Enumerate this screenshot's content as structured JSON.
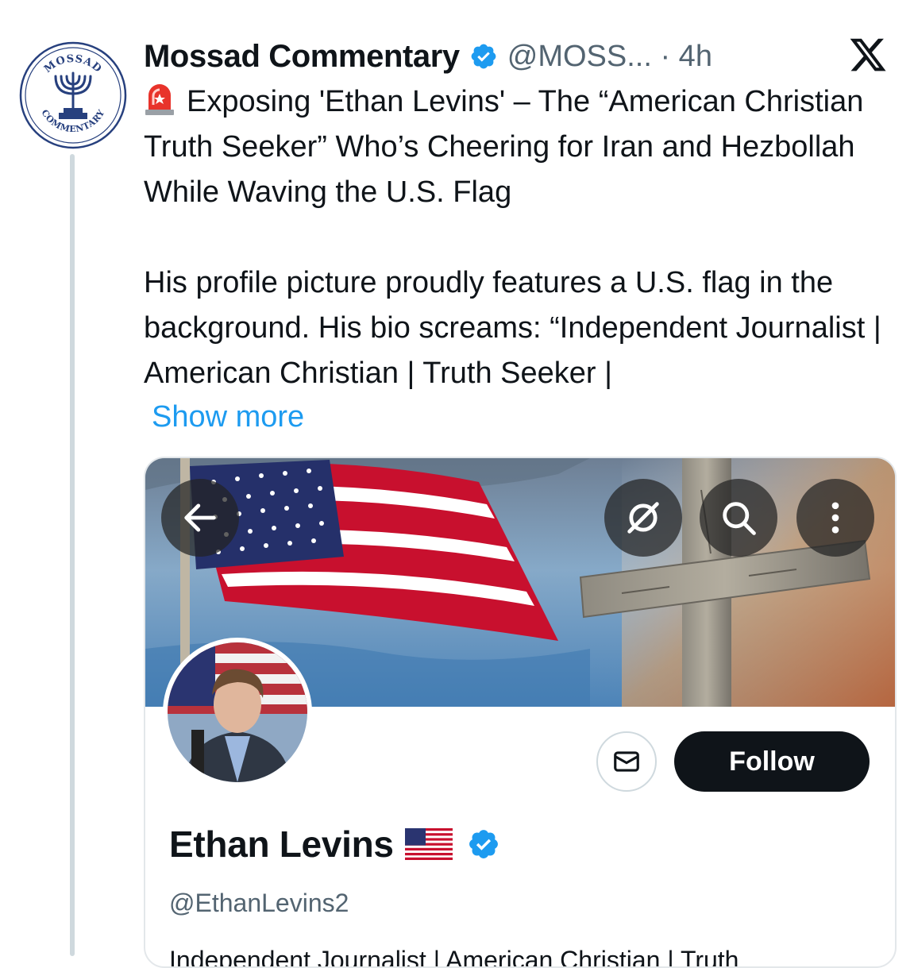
{
  "author": {
    "display_name": "Mossad Commentary",
    "handle_time": "@MOSS... · 4h",
    "avatar_text_top": "MOSSAD",
    "avatar_text_bottom": "COMMENTARY",
    "verified_icon": "verified-badge-icon"
  },
  "tweet": {
    "headline": "Exposing 'Ethan Levins' – The “American Christian Truth Seeker” Who’s Cheering for Iran and Hezbollah While Waving the U.S. Flag",
    "body": "His profile picture proudly features a U.S. flag in the background. His bio screams: “Independent Journalist | American Christian | Truth Seeker |",
    "show_more": "Show more"
  },
  "profile_card": {
    "name": "Ethan Levins",
    "handle": "@EthanLevins2",
    "follow_label": "Follow",
    "bio_peek": "Independent Journalist | American Christian | Truth"
  },
  "colors": {
    "accent_blue": "#1d9bf0",
    "text_primary": "#0f1419",
    "text_secondary": "#536471",
    "thread_line": "#cfd9de"
  },
  "icons": [
    "x-logo-icon",
    "siren-icon",
    "back-arrow-icon",
    "hide-icon",
    "search-icon",
    "more-icon",
    "message-icon",
    "us-flag-icon"
  ]
}
